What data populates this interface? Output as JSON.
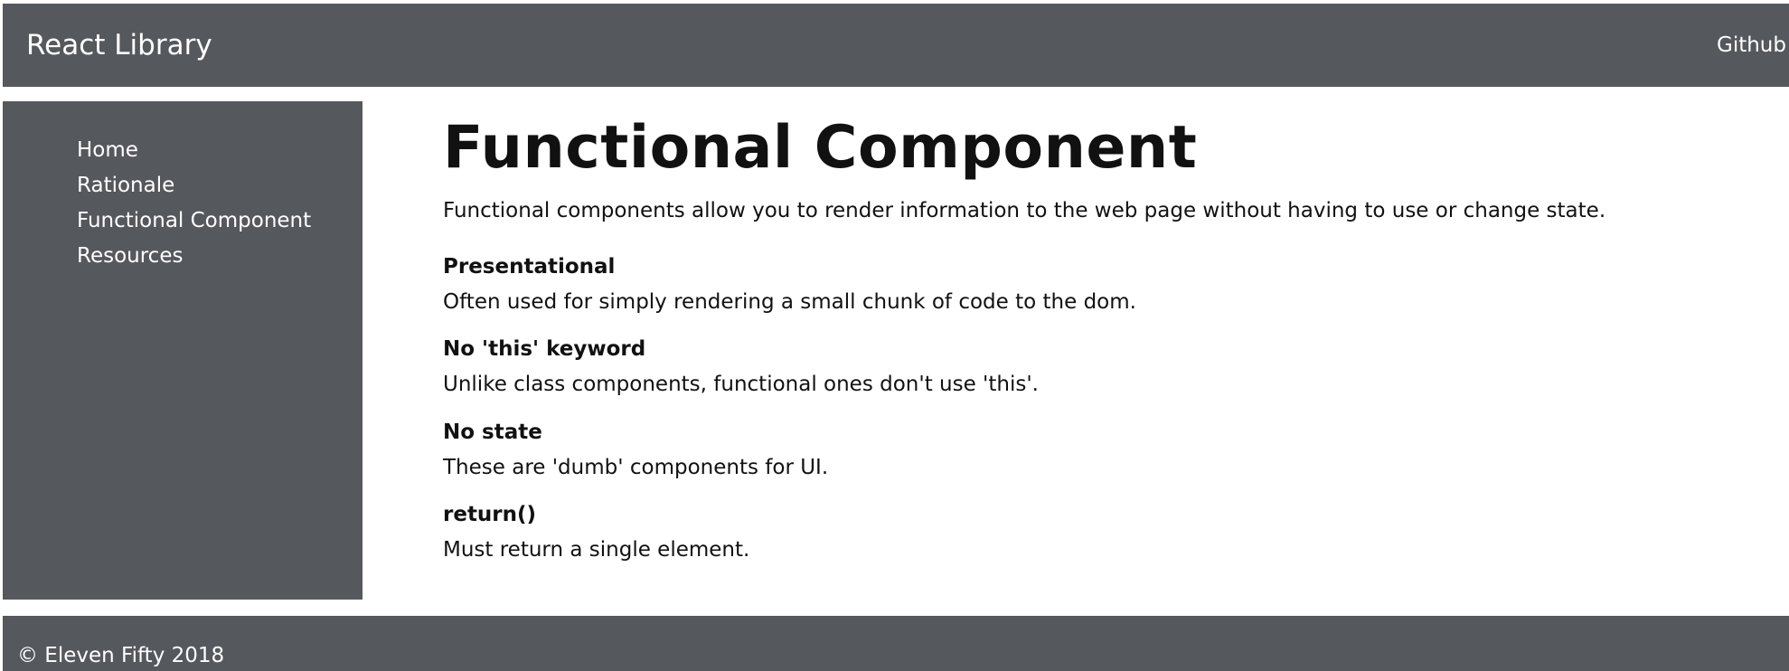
{
  "navbar": {
    "brand": "React Library",
    "github_label": "Github"
  },
  "sidebar": {
    "items": [
      {
        "label": "Home"
      },
      {
        "label": "Rationale"
      },
      {
        "label": "Functional Component"
      },
      {
        "label": "Resources"
      }
    ]
  },
  "main": {
    "title": "Functional Component",
    "intro": "Functional components allow you to render information to the web page without having to use or change state.",
    "features": [
      {
        "title": "Presentational",
        "description": "Often used for simply rendering a small chunk of code to the dom."
      },
      {
        "title": "No 'this' keyword",
        "description": "Unlike class components, functional ones don't use 'this'."
      },
      {
        "title": "No state",
        "description": "These are 'dumb' components for UI."
      },
      {
        "title": "return()",
        "description": "Must return a single element."
      }
    ]
  },
  "footer": {
    "copyright": "© Eleven Fifty 2018"
  },
  "colors": {
    "chrome_background": "#55585c",
    "chrome_text": "#ffffff",
    "content_text": "#111111",
    "content_background": "#ffffff"
  }
}
